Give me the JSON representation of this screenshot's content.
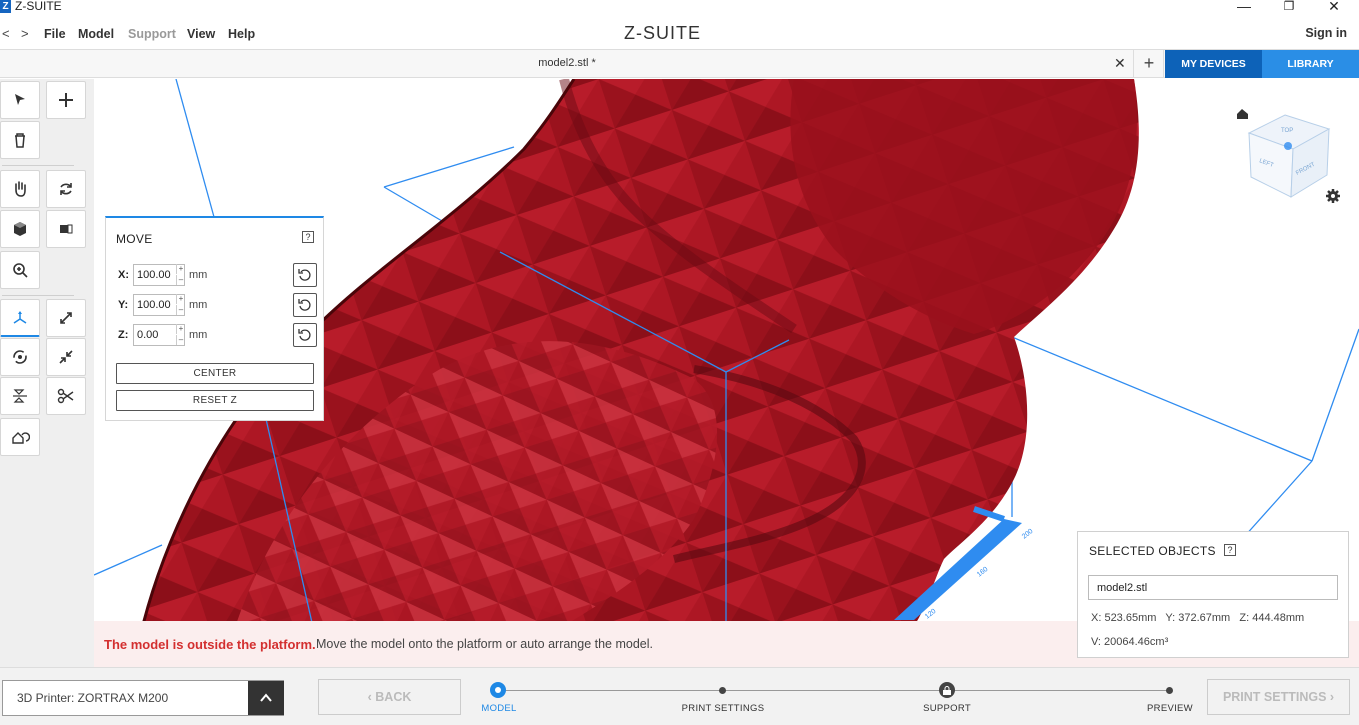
{
  "app": {
    "logo": "Z",
    "title": "Z-SUITE",
    "brand": "Z-SUITE"
  },
  "window_controls": {
    "minimize": "—",
    "maximize": "❐",
    "close": "✕"
  },
  "menu": {
    "back_arrow": "<",
    "forward_arrow": ">",
    "items": [
      "File",
      "Model",
      "Support",
      "View",
      "Help"
    ],
    "sign_in": "Sign in"
  },
  "tabs": {
    "file_tab": "model2.stl *",
    "close": "✕",
    "new_tab": "+",
    "my_devices": "MY DEVICES",
    "library": "LIBRARY"
  },
  "move_panel": {
    "title": "MOVE",
    "help": "?",
    "x": {
      "label": "X:",
      "value": "100.00",
      "unit": "mm"
    },
    "y": {
      "label": "Y:",
      "value": "100.00",
      "unit": "mm"
    },
    "z": {
      "label": "Z:",
      "value": "0.00",
      "unit": "mm"
    },
    "center_button": "CENTER",
    "reset_z_button": "RESET Z"
  },
  "view_cube": {
    "top": "TOP",
    "left": "LEFT",
    "front": "FRONT"
  },
  "platform_ticks": [
    "200",
    "160",
    "120"
  ],
  "warning": {
    "bold": "The model is outside the platform.",
    "text": "Move the model onto the platform or auto arrange the model."
  },
  "selected_objects": {
    "title": "SELECTED OBJECTS",
    "help": "?",
    "name": "model2.stl",
    "dims": "X: 523.65mm   Y: 372.67mm   Z: 444.48mm",
    "volume": "V: 20064.46cm³"
  },
  "bottom": {
    "printer": "3D Printer: ZORTRAX M200",
    "back": "BACK",
    "steps": [
      "MODEL",
      "PRINT SETTINGS",
      "SUPPORT",
      "PREVIEW"
    ],
    "print_settings": "PRINT SETTINGS"
  },
  "colors": {
    "accent": "#1e88e5",
    "model": "#a3141f",
    "warning": "#d32f2f",
    "devices": "#0d62b8",
    "library": "#2a8ee6"
  }
}
